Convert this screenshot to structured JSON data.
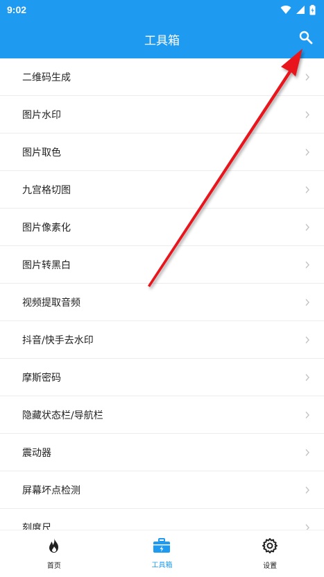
{
  "status_bar": {
    "time": "9:02"
  },
  "app_bar": {
    "title": "工具箱",
    "search_icon": "search-icon"
  },
  "tools": [
    {
      "label": "二维码生成"
    },
    {
      "label": "图片水印"
    },
    {
      "label": "图片取色"
    },
    {
      "label": "九宫格切图"
    },
    {
      "label": "图片像素化"
    },
    {
      "label": "图片转黑白"
    },
    {
      "label": "视频提取音频"
    },
    {
      "label": "抖音/快手去水印"
    },
    {
      "label": "摩斯密码"
    },
    {
      "label": "隐藏状态栏/导航栏"
    },
    {
      "label": "震动器"
    },
    {
      "label": "屏幕坏点检测"
    },
    {
      "label": "刻度尺"
    }
  ],
  "bottom_nav": {
    "tabs": [
      {
        "label": "首页",
        "icon": "fire-icon"
      },
      {
        "label": "工具箱",
        "icon": "toolbox-icon",
        "active": true
      },
      {
        "label": "设置",
        "icon": "gear-icon"
      }
    ]
  },
  "colors": {
    "primary": "#1e9bf0",
    "annotation_arrow": "#e8141b"
  }
}
